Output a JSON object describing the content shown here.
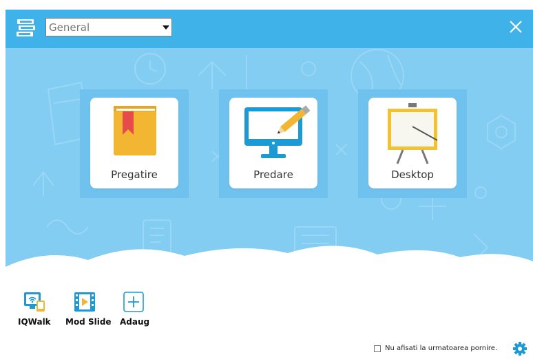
{
  "header": {
    "profile_select": {
      "value": "General"
    },
    "icons": {
      "app": "stacked-books-icon",
      "dropdown": "chevron-down-icon",
      "close": "close-icon"
    }
  },
  "tiles": [
    {
      "label": "Pregatire",
      "icon": "book-icon"
    },
    {
      "label": "Predare",
      "icon": "monitor-pen-icon"
    },
    {
      "label": "Desktop",
      "icon": "whiteboard-icon"
    }
  ],
  "tools": [
    {
      "label": "IQWalk",
      "icon": "wireless-monitor-icon"
    },
    {
      "label": "Mod Slide",
      "icon": "film-play-icon"
    },
    {
      "label": "Adaug",
      "icon": "add-icon"
    }
  ],
  "footer": {
    "checkbox_label": "Nu afisati la urmatoarea pornire.",
    "checked": false,
    "settings_icon": "gear-icon"
  },
  "colors": {
    "header": "#3fb2ea",
    "background": "#83cdf3",
    "tile_backdrop": "#6fc1ee",
    "accent_blue": "#1b9ad6",
    "book_yellow": "#f2b632",
    "bookmark_red": "#e64a4a"
  }
}
